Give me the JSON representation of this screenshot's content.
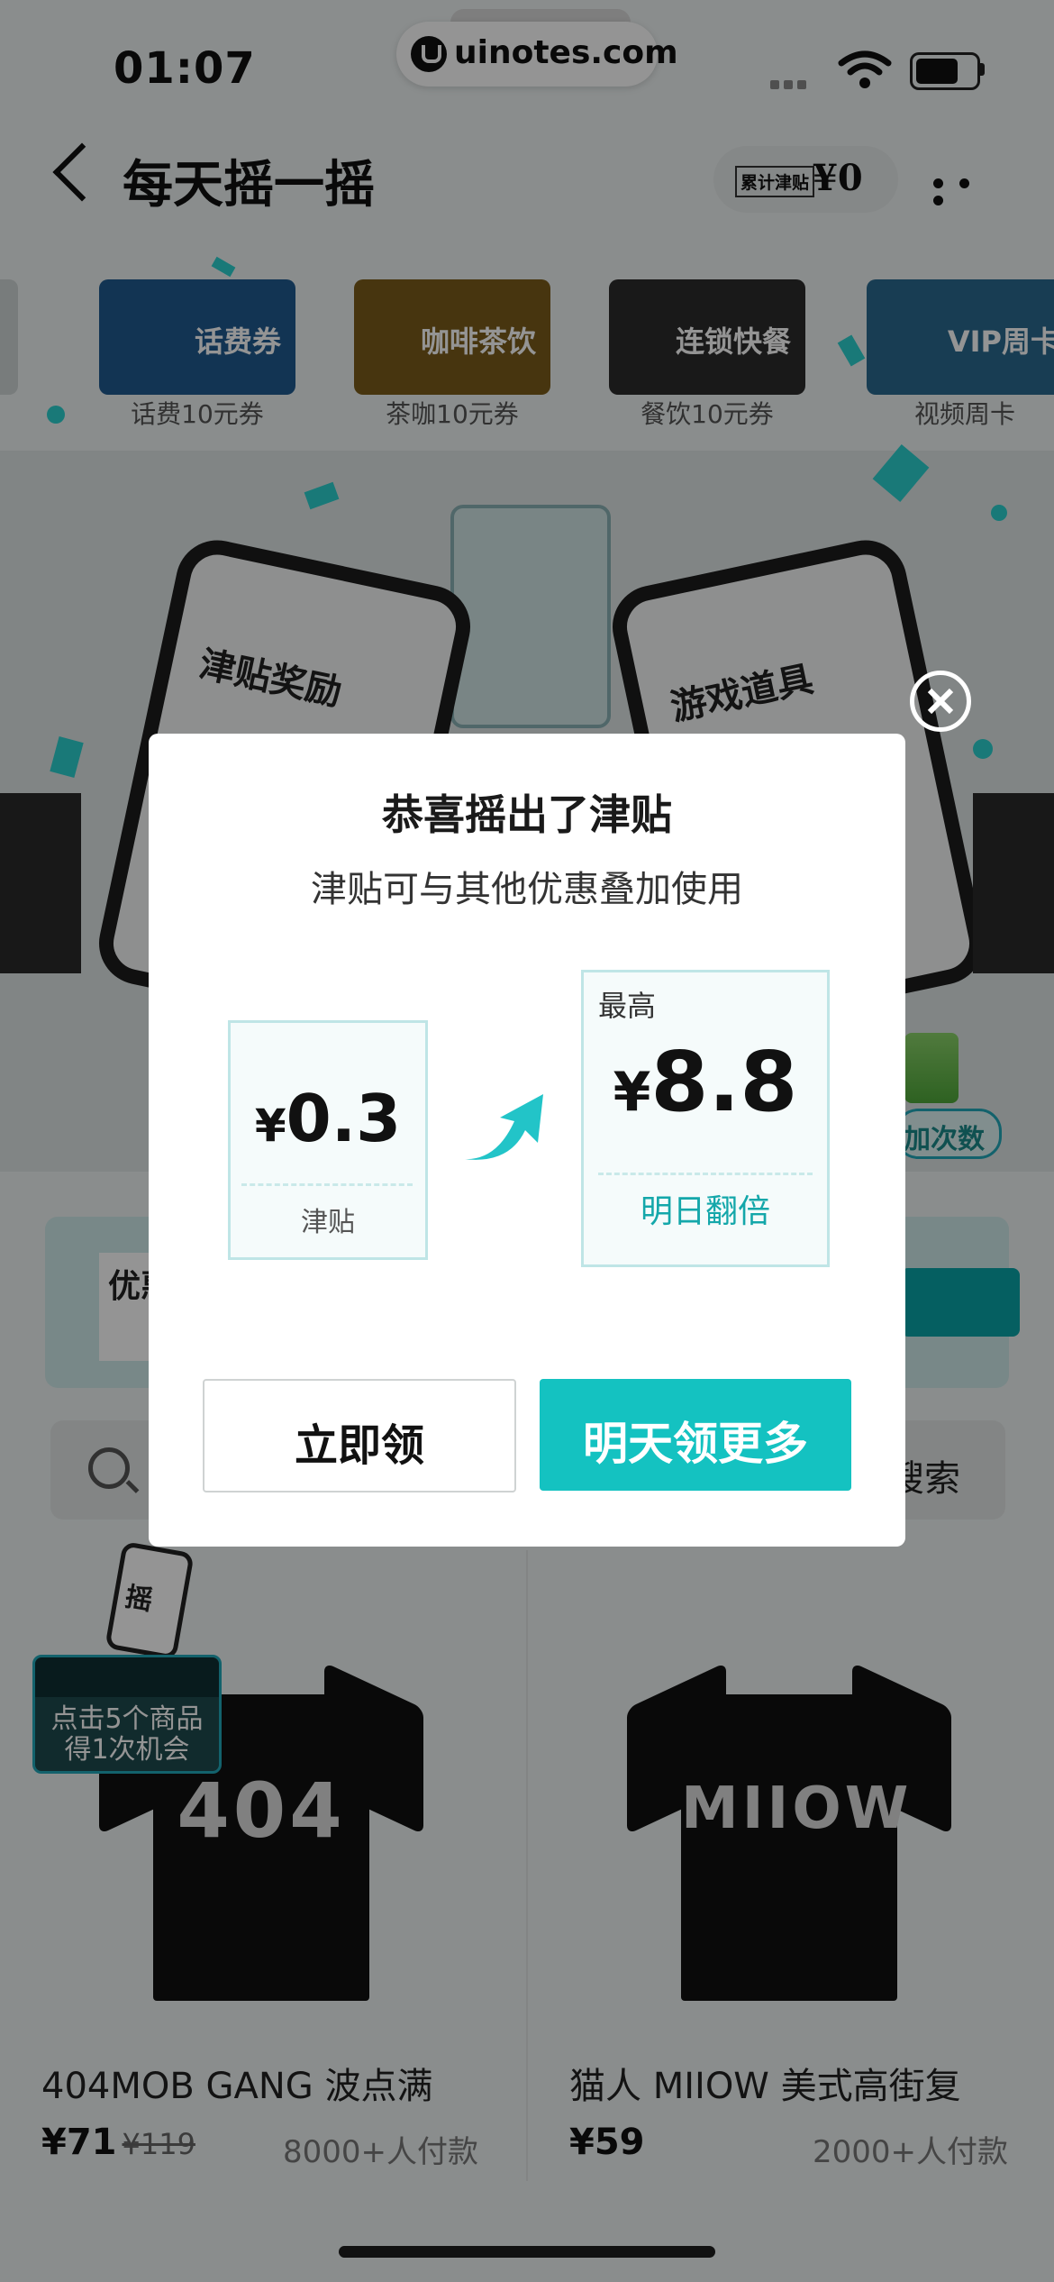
{
  "status": {
    "time": "01:07"
  },
  "watermark": "uinotes.com",
  "nav": {
    "title": "每天摇一摇",
    "subsidy_label": "累计津贴",
    "subsidy_amount": "¥0"
  },
  "coupons": [
    {
      "tile": "话费券",
      "caption": "话费10元券",
      "color": "#1f5a8f"
    },
    {
      "tile": "咖啡茶饮",
      "caption": "茶咖10元券",
      "color": "#7a5c1a"
    },
    {
      "tile": "连锁快餐",
      "caption": "餐饮10元券",
      "color": "#2b2b2b"
    },
    {
      "tile": "VIP周卡",
      "caption": "视频周卡",
      "color": "#2a6a8f"
    }
  ],
  "hero": {
    "left_phone": "津贴奖励",
    "right_phone": "游戏道具",
    "add_chance": "加次数"
  },
  "coupon_panel": {
    "title": "优惠"
  },
  "search": {
    "button": "搜索"
  },
  "shake_badge": {
    "text1": "点击5个商品",
    "text2": "得1次机会",
    "phone_text": "摇"
  },
  "products": [
    {
      "title": "404MOB GANG 波点满",
      "price": "¥71",
      "original_price": "¥119",
      "sold": "8000+人付款",
      "print": "404"
    },
    {
      "title": "猫人 MIIOW 美式高街复",
      "price": "¥59",
      "original_price": "",
      "sold": "2000+人付款",
      "print": "MIIOW"
    }
  ],
  "modal": {
    "title": "恭喜摇出了津贴",
    "subtitle": "津贴可与其他优惠叠加使用",
    "current": {
      "currency": "¥",
      "value": "0.3",
      "label": "津贴"
    },
    "max": {
      "top_label": "最高",
      "currency": "¥",
      "value": "8.8",
      "label": "明日翻倍"
    },
    "claim_button": "立即领",
    "more_button": "明天领更多"
  },
  "colors": {
    "accent": "#14c2c1",
    "accent_text": "#14a7aa"
  }
}
